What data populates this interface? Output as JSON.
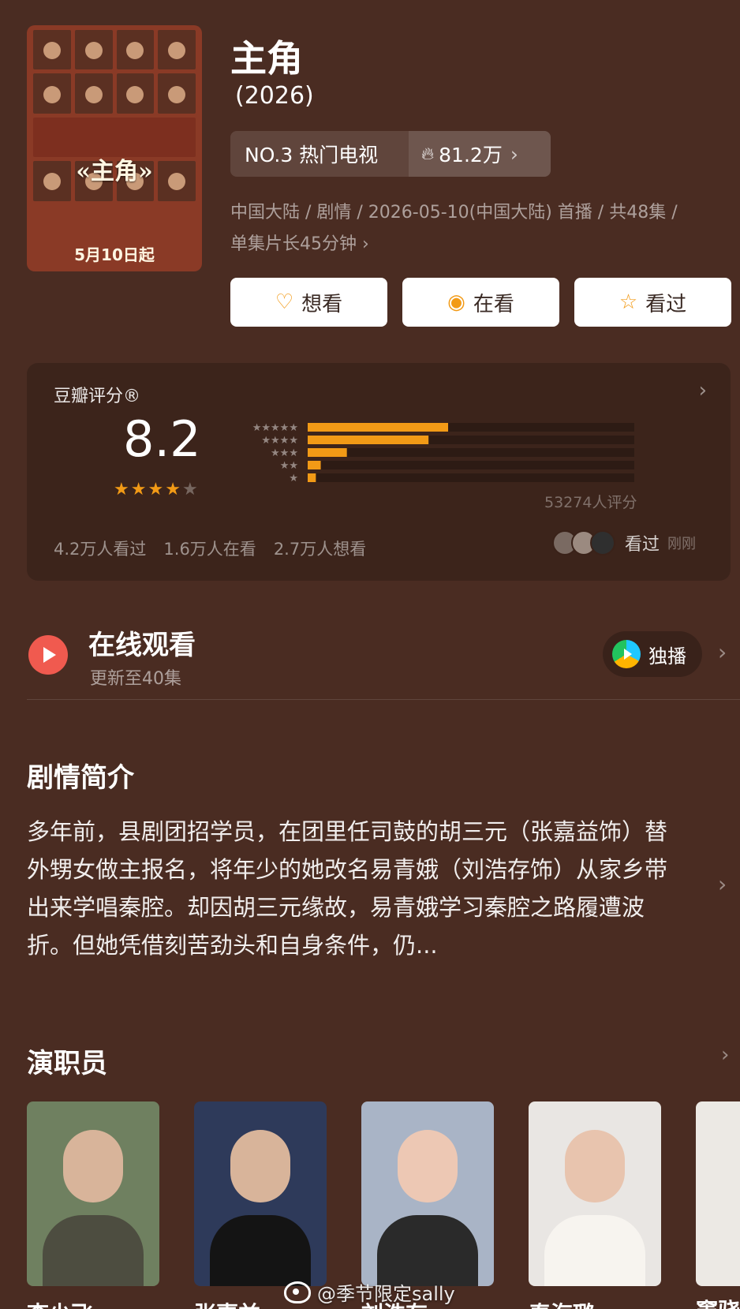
{
  "poster": {
    "title": "«主角»",
    "date": "5月10日起"
  },
  "header": {
    "title": "主角",
    "year": "(2026)",
    "rank": "NO.3 热门电视",
    "heat": "81.2万",
    "meta_line1": "中国大陆 / 剧情 / 2026-05-10(中国大陆) 首播 / 共48集 /",
    "meta_line2": "单集片长45分钟"
  },
  "actions": [
    {
      "label": "想看",
      "icon": "heart-plus-icon"
    },
    {
      "label": "在看",
      "icon": "target-icon"
    },
    {
      "label": "看过",
      "icon": "star-outline-icon"
    }
  ],
  "rating": {
    "label": "豆瓣评分®",
    "score": "8.2",
    "stars_filled": 4,
    "stars_total": 5,
    "count_text": "53274人评分",
    "stats": [
      "4.2万人看过",
      "1.6万人在看",
      "2.7万人想看"
    ],
    "friends_action": "看过",
    "friends_time": "刚刚",
    "accent_color": "#f29a16"
  },
  "chart_data": {
    "type": "bar",
    "orientation": "horizontal",
    "categories": [
      "5星",
      "4星",
      "3星",
      "2星",
      "1星"
    ],
    "values": [
      0.43,
      0.37,
      0.12,
      0.04,
      0.025
    ],
    "xlim": [
      0,
      1
    ]
  },
  "watch": {
    "title": "在线观看",
    "subtitle": "更新至40集",
    "badge": "独播"
  },
  "synopsis": {
    "title": "剧情简介",
    "text": "多年前，县剧团招学员，在团里任司鼓的胡三元（张嘉益饰）替外甥女做主报名，将年少的她改名易青娥（刘浩存饰）从家乡带出来学唱秦腔。却因胡三元缘故，易青娥学习秦腔之路履遭波折。但她凭借刻苦劲头和自身条件，仍..."
  },
  "cast": {
    "title": "演职员",
    "people": [
      {
        "name": "李少飞"
      },
      {
        "name": "张嘉益"
      },
      {
        "name": "刘浩存"
      },
      {
        "name": "秦海璐"
      }
    ],
    "partial_name": "窦骁"
  },
  "watermark": "@季节限定sally"
}
